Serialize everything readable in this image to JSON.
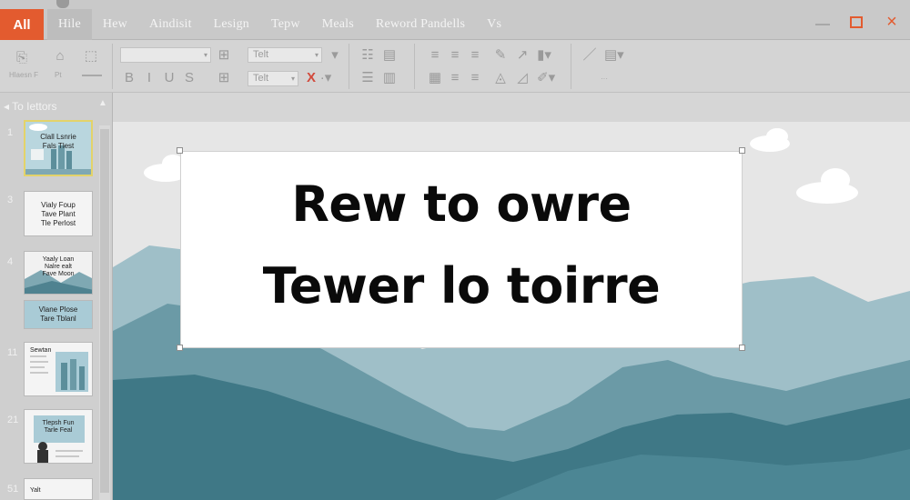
{
  "menubar": {
    "active_tab": "All",
    "tabs": [
      "Hile",
      "Hew",
      "Aindisit",
      "Lesign",
      "Tepw",
      "Meals",
      "Reword Pandells",
      "Vs"
    ]
  },
  "ribbon": {
    "clipboard_label": "Hlaesn F",
    "paste_label": "Pt",
    "font_box_1": "Telt",
    "font_box_2": "Telt"
  },
  "panel": {
    "header": "To Iettors",
    "slides": [
      {
        "num": "1",
        "lines": [
          "Clall Lsnrie",
          "Fals Tlest"
        ]
      },
      {
        "num": "3",
        "lines": [
          "Vialy Foup",
          "Tave Plant",
          "Tle Perlost"
        ]
      },
      {
        "num": "4",
        "lines": [
          "Yaaly Loan",
          "Nalre ealt",
          "Fave Moon"
        ]
      },
      {
        "num": "",
        "lines": [
          "Vlane Plose",
          "Tare Tblanl"
        ]
      },
      {
        "num": "11",
        "lines": [
          "Sewtan"
        ]
      },
      {
        "num": "21",
        "lines": [
          "Tlepsh Fun",
          "Tarle Feal"
        ]
      },
      {
        "num": "51",
        "lines": [
          "Yalt"
        ]
      }
    ]
  },
  "slide": {
    "title_line1": "Rew to owre",
    "title_line2": "Tewer lo  toirre"
  },
  "colors": {
    "accent": "#e35b2f",
    "mountain_dark": "#3f7886",
    "mountain_mid": "#6b9aa6",
    "mountain_light": "#9fbfc8",
    "sky": "#e6e6e6"
  }
}
